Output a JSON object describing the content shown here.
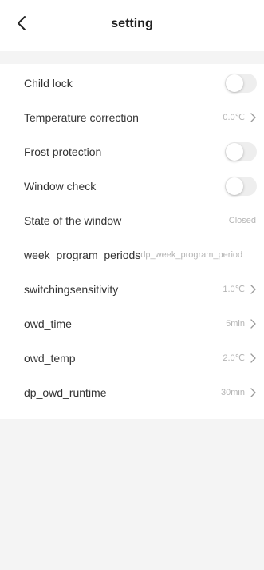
{
  "header": {
    "back_icon": "chevron-left-icon",
    "title": "setting"
  },
  "colors": {
    "page_background": "#f4f4f4",
    "card_background": "#ffffff",
    "label_text": "#333333",
    "value_text": "#b5b5b5",
    "toggle_off": "#eeeeee"
  },
  "settings": {
    "child_lock": {
      "label": "Child lock",
      "toggle_on": false
    },
    "temperature_correction": {
      "label": "Temperature correction",
      "value": "0.0℃"
    },
    "frost_protection": {
      "label": "Frost protection",
      "toggle_on": false
    },
    "window_check": {
      "label": "Window check",
      "toggle_on": false
    },
    "state_of_window": {
      "label": "State of the window",
      "value": "Closed"
    },
    "week_program_periods": {
      "label": "week_program_periods",
      "value": "dp_week_program_period"
    },
    "switching_sensitivity": {
      "label": "switchingsensitivity",
      "value": "1.0℃"
    },
    "owd_time": {
      "label": "owd_time",
      "value": "5min"
    },
    "owd_temp": {
      "label": "owd_temp",
      "value": "2.0℃"
    },
    "dp_owd_runtime": {
      "label": "dp_owd_runtime",
      "value": "30min"
    }
  },
  "icons": {
    "row_chevron": "chevron-right-icon"
  }
}
